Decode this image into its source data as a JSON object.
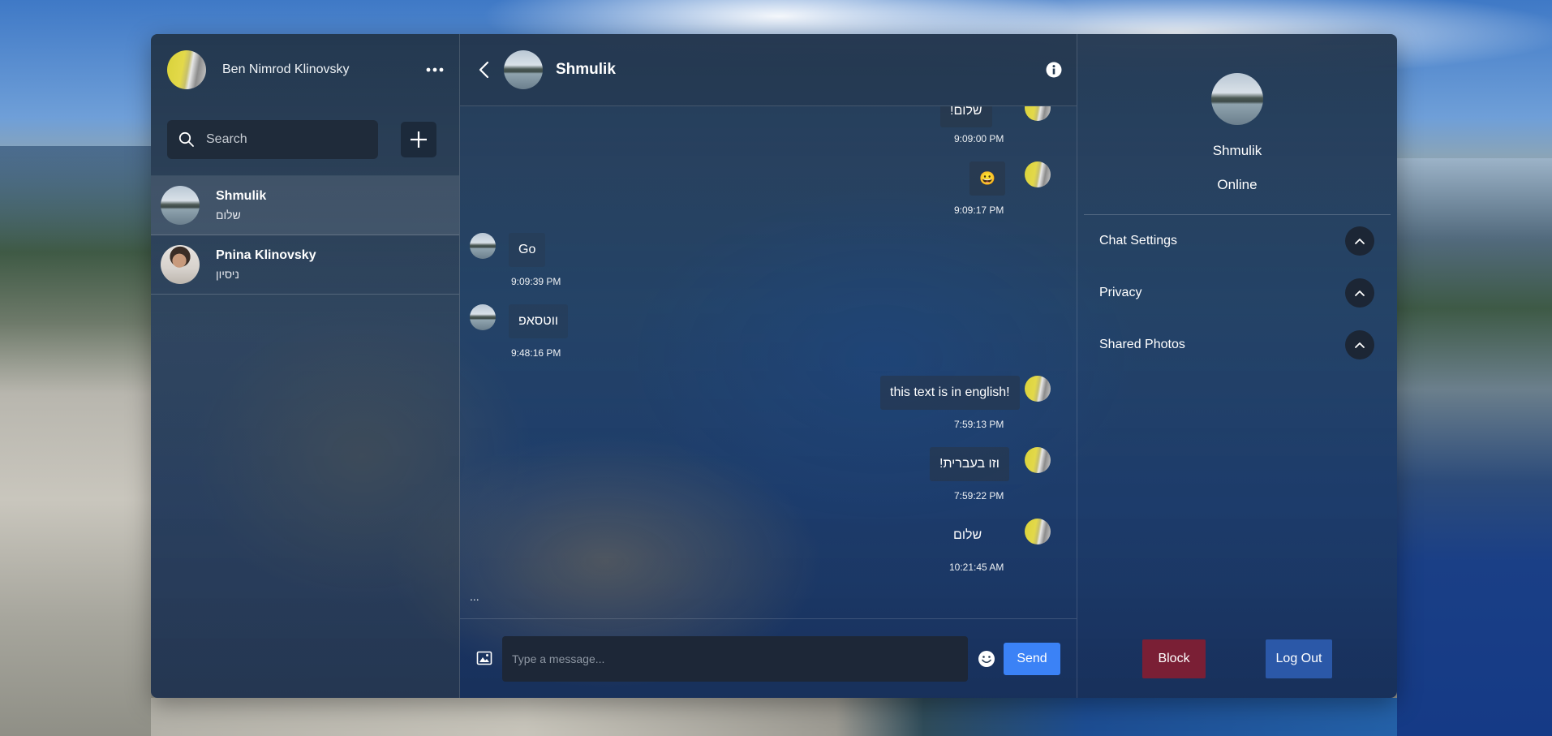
{
  "user": {
    "name": "Ben Nimrod Klinovsky",
    "avatar_icon": "avatar-icon"
  },
  "sidebar": {
    "menu_icon": "more-dots-icon",
    "search": {
      "placeholder": "Search",
      "value": ""
    },
    "add_icon": "plus-icon",
    "conversations": [
      {
        "name": "Shmulik",
        "preview": "שלום",
        "active": true
      },
      {
        "name": "Pnina Klinovsky",
        "preview": "ניסיון",
        "active": false
      }
    ]
  },
  "chat": {
    "title": "Shmulik",
    "messages": [
      {
        "direction": "out",
        "text": "שלום!",
        "time": "9:09:00 PM"
      },
      {
        "direction": "out",
        "text": "😀",
        "time": "9:09:17 PM"
      },
      {
        "direction": "in",
        "text": "Go",
        "time": "9:09:39 PM"
      },
      {
        "direction": "in",
        "text": "ווטסאפ",
        "time": "9:48:16 PM"
      },
      {
        "direction": "out",
        "text": "this text is in english!",
        "time": "7:59:13 PM"
      },
      {
        "direction": "out",
        "text": "וזו בעברית!",
        "time": "7:59:22 PM"
      },
      {
        "direction": "out",
        "text": "שלום",
        "time": "10:21:45 AM"
      }
    ],
    "typing_indicator": "...",
    "composer": {
      "placeholder": "Type a message...",
      "value": "",
      "send_label": "Send"
    }
  },
  "info_panel": {
    "name": "Shmulik",
    "status": "Online",
    "sections": [
      {
        "label": "Chat Settings",
        "expanded": false
      },
      {
        "label": "Privacy",
        "expanded": false
      },
      {
        "label": "Shared Photos",
        "expanded": false
      }
    ],
    "block_label": "Block",
    "logout_label": "Log Out"
  },
  "colors": {
    "send": "#3b82f6",
    "block": "#7a1f35",
    "logout": "#2b58a8",
    "input_bg": "#1d2737"
  }
}
